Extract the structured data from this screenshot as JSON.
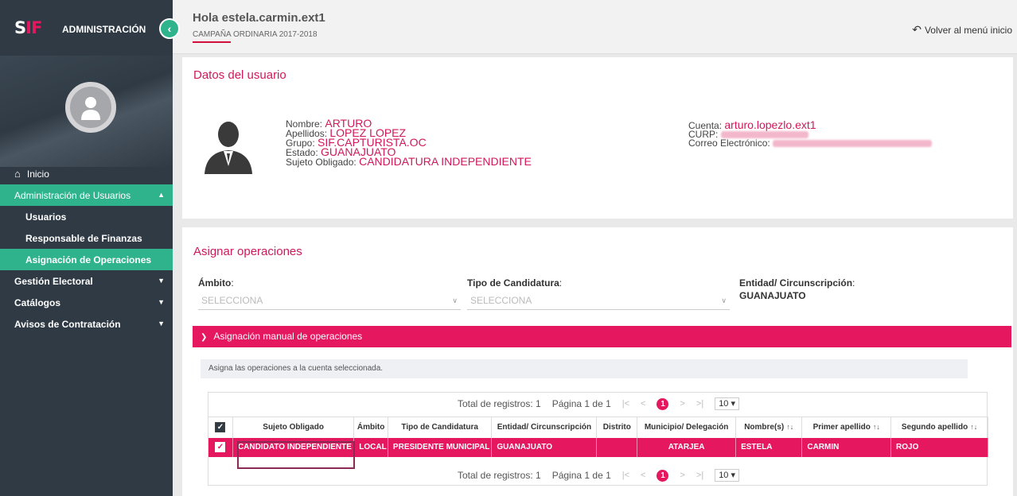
{
  "sidebar": {
    "logo_s": "S",
    "logo_if": "IF",
    "title": "ADMINISTRACIÓN",
    "nav": [
      {
        "label": "Inicio"
      },
      {
        "label": "Administración de Usuarios"
      },
      {
        "label": "Usuarios"
      },
      {
        "label": "Responsable de Finanzas"
      },
      {
        "label": "Asignación de Operaciones"
      },
      {
        "label": "Gestión Electoral"
      },
      {
        "label": "Catálogos"
      },
      {
        "label": "Avisos de Contratación"
      }
    ]
  },
  "header": {
    "greeting": "Hola estela.carmin.ext1",
    "campaign": "CAMPAÑA ORDINARIA 2017-2018",
    "back_label": "Volver al menú inicio"
  },
  "user_card": {
    "title": "Datos del usuario",
    "nombre_label": "Nombre:",
    "nombre": "ARTURO",
    "apellidos_label": "Apellidos:",
    "apellidos": "LOPEZ LOPEZ",
    "grupo_label": "Grupo:",
    "grupo": "SIF.CAPTURISTA.OC",
    "estado_label": "Estado:",
    "estado": "GUANAJUATO",
    "sujeto_label": "Sujeto Obligado:",
    "sujeto": "CANDIDATURA INDEPENDIENTE",
    "cuenta_label": "Cuenta:",
    "cuenta": "arturo.lopezlo.ext1",
    "curp_label": "CURP:",
    "correo_label": "Correo Electrónico:"
  },
  "assign_card": {
    "title": "Asignar operaciones",
    "ambito_label": "Ámbito",
    "ambito_placeholder": "SELECCIONA",
    "tipo_label": "Tipo de Candidatura",
    "tipo_placeholder": "SELECCIONA",
    "entidad_label": "Entidad/ Circunscripción",
    "entidad_value": "GUANAJUATO",
    "section_title": "Asignación manual de operaciones",
    "hint": "Asigna las operaciones a la cuenta seleccionada.",
    "pager": {
      "total": "Total de registros: 1",
      "page": "Página 1 de 1",
      "current": "1",
      "size": "10"
    },
    "columns": [
      "Sujeto Obligado",
      "Ámbito",
      "Tipo de Candidatura",
      "Entidad/ Circunscripción",
      "Distrito",
      "Municipio/ Delegación",
      "Nombre(s)",
      "Primer apellido",
      "Segundo apellido"
    ],
    "row": {
      "sujeto": "CANDIDATO INDEPENDIENTE",
      "ambito": "LOCAL",
      "tipo": "PRESIDENTE MUNICIPAL",
      "entidad": "GUANAJUATO",
      "distrito": "",
      "municipio": "ATARJEA",
      "nombre": "ESTELA",
      "primer": "CARMIN",
      "segundo": "ROJO"
    }
  },
  "colors": {
    "accent": "#e5175f",
    "sidebar_bg": "#2f3a44",
    "active_nav": "#2fb38c"
  }
}
